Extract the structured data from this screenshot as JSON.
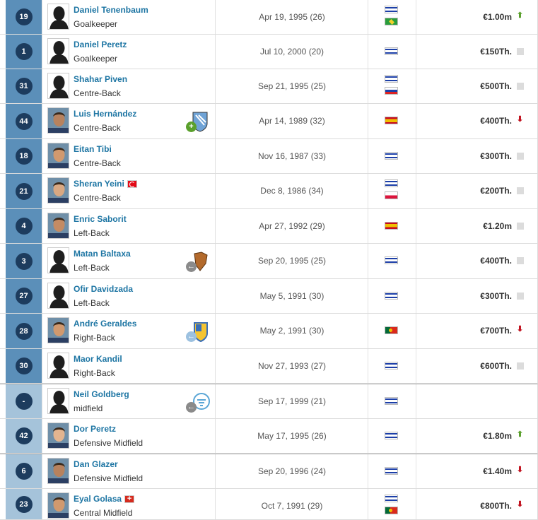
{
  "players": [
    {
      "number": "19",
      "name": "Daniel Tenenbaum",
      "position": "Goalkeeper",
      "dob": "Apr 19, 1995 (26)",
      "flags": [
        "isr",
        "bra"
      ],
      "value": "€1.00m",
      "trend": "up",
      "group": "def",
      "photo": "silhouette",
      "club": null,
      "name_flag": null
    },
    {
      "number": "1",
      "name": "Daniel Peretz",
      "position": "Goalkeeper",
      "dob": "Jul 10, 2000 (20)",
      "flags": [
        "isr"
      ],
      "value": "€150Th.",
      "trend": "none",
      "group": "def",
      "photo": "silhouette",
      "club": null,
      "name_flag": null
    },
    {
      "number": "31",
      "name": "Shahar Piven",
      "position": "Centre-Back",
      "dob": "Sep 21, 1995 (25)",
      "flags": [
        "isr",
        "rus"
      ],
      "value": "€500Th.",
      "trend": "none",
      "group": "def",
      "photo": "silhouette",
      "club": null,
      "name_flag": null
    },
    {
      "number": "44",
      "name": "Luis Hernández",
      "position": "Centre-Back",
      "dob": "Apr 14, 1989 (32)",
      "flags": [
        "esp"
      ],
      "value": "€400Th.",
      "trend": "down",
      "group": "def",
      "photo": "face",
      "club": {
        "icon": "malaga-crest-icon",
        "direction": "in"
      },
      "name_flag": null
    },
    {
      "number": "18",
      "name": "Eitan Tibi",
      "position": "Centre-Back",
      "dob": "Nov 16, 1987 (33)",
      "flags": [
        "isr"
      ],
      "value": "€300Th.",
      "trend": "none",
      "group": "def",
      "photo": "face",
      "club": null,
      "name_flag": null
    },
    {
      "number": "21",
      "name": "Sheran Yeini",
      "position": "Centre-Back",
      "dob": "Dec 8, 1986 (34)",
      "flags": [
        "isr",
        "pol"
      ],
      "value": "€200Th.",
      "trend": "none",
      "group": "def",
      "photo": "face",
      "club": null,
      "name_flag": "tur"
    },
    {
      "number": "4",
      "name": "Enric Saborit",
      "position": "Left-Back",
      "dob": "Apr 27, 1992 (29)",
      "flags": [
        "esp"
      ],
      "value": "€1.20m",
      "trend": "none",
      "group": "def",
      "photo": "face",
      "club": null,
      "name_flag": null
    },
    {
      "number": "3",
      "name": "Matan Baltaxa",
      "position": "Left-Back",
      "dob": "Sep 20, 1995 (25)",
      "flags": [
        "isr"
      ],
      "value": "€400Th.",
      "trend": "none",
      "group": "def",
      "photo": "silhouette",
      "club": {
        "icon": "club-crest-icon",
        "direction": "back"
      },
      "name_flag": null
    },
    {
      "number": "27",
      "name": "Ofir Davidzada",
      "position": "Left-Back",
      "dob": "May 5, 1991 (30)",
      "flags": [
        "isr"
      ],
      "value": "€300Th.",
      "trend": "none",
      "group": "def",
      "photo": "silhouette",
      "club": null,
      "name_flag": null
    },
    {
      "number": "28",
      "name": "André Geraldes",
      "position": "Right-Back",
      "dob": "May 2, 1991 (30)",
      "flags": [
        "por"
      ],
      "value": "€700Th.",
      "trend": "down",
      "group": "def",
      "photo": "face",
      "club": {
        "icon": "apoel-crest-icon",
        "direction": "back-light"
      },
      "name_flag": null
    },
    {
      "number": "30",
      "name": "Maor Kandil",
      "position": "Right-Back",
      "dob": "Nov 27, 1993 (27)",
      "flags": [
        "isr"
      ],
      "value": "€600Th.",
      "trend": "none",
      "group": "def",
      "photo": "silhouette",
      "club": null,
      "name_flag": null
    },
    {
      "number": "-",
      "name": "Neil Goldberg",
      "position": "midfield",
      "dob": "Sep 17, 1999 (21)",
      "flags": [
        "isr"
      ],
      "value": "",
      "trend": "",
      "group": "mid",
      "photo": "silhouette",
      "club": {
        "icon": "hapoel-crest-icon",
        "direction": "back"
      },
      "name_flag": null
    },
    {
      "number": "42",
      "name": "Dor Peretz",
      "position": "Defensive Midfield",
      "dob": "May 17, 1995 (26)",
      "flags": [
        "isr"
      ],
      "value": "€1.80m",
      "trend": "up",
      "group": "mid",
      "photo": "face",
      "club": null,
      "name_flag": null
    },
    {
      "number": "6",
      "name": "Dan Glazer",
      "position": "Defensive Midfield",
      "dob": "Sep 20, 1996 (24)",
      "flags": [
        "isr"
      ],
      "value": "€1.40m",
      "trend": "down",
      "group": "mid",
      "photo": "face",
      "club": null,
      "name_flag": null
    },
    {
      "number": "23",
      "name": "Eyal Golasa",
      "position": "Central Midfield",
      "dob": "Oct 7, 1991 (29)",
      "flags": [
        "isr",
        "por"
      ],
      "value": "€800Th.",
      "trend": "down",
      "group": "mid",
      "photo": "face",
      "club": null,
      "name_flag": "sui"
    }
  ],
  "colors": {
    "defender_band": "#5b8fb9",
    "midfield_band": "#a5c3da",
    "number_circle": "#1d3c5e",
    "name_link": "#1d75a3",
    "trend_up": "#5aa02c",
    "trend_down": "#c1121f"
  }
}
